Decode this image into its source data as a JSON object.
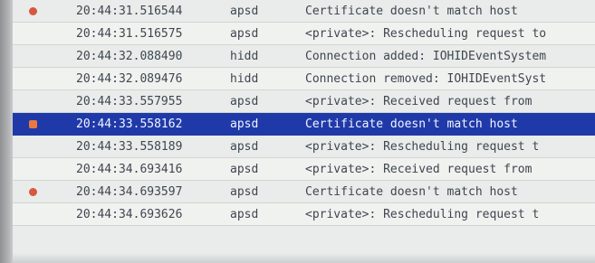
{
  "log": {
    "rows": [
      {
        "time": "20:44:31.516544",
        "process": "apsd",
        "message": "Certificate doesn't match host",
        "fault": true,
        "selected": false
      },
      {
        "time": "20:44:31.516575",
        "process": "apsd",
        "message": "<private>: Rescheduling request to",
        "fault": false,
        "selected": false
      },
      {
        "time": "20:44:32.088490",
        "process": "hidd",
        "message": "Connection added: IOHIDEventSystem",
        "fault": false,
        "selected": false
      },
      {
        "time": "20:44:32.089476",
        "process": "hidd",
        "message": "Connection removed: IOHIDEventSyst",
        "fault": false,
        "selected": false
      },
      {
        "time": "20:44:33.557955",
        "process": "apsd",
        "message": "<private>: Received request from",
        "fault": false,
        "selected": false
      },
      {
        "time": "20:44:33.558162",
        "process": "apsd",
        "message": "Certificate doesn't match host",
        "fault": true,
        "selected": true
      },
      {
        "time": "20:44:33.558189",
        "process": "apsd",
        "message": "<private>: Rescheduling request t",
        "fault": false,
        "selected": false
      },
      {
        "time": "20:44:34.693416",
        "process": "apsd",
        "message": "<private>: Received request from",
        "fault": false,
        "selected": false
      },
      {
        "time": "20:44:34.693597",
        "process": "apsd",
        "message": "Certificate doesn't match host",
        "fault": true,
        "selected": false
      },
      {
        "time": "20:44:34.693626",
        "process": "apsd",
        "message": "<private>: Rescheduling request t",
        "fault": false,
        "selected": false
      }
    ]
  },
  "colors": {
    "selection": "#1f3aa8",
    "fault_dot": "#d8573f"
  },
  "icons": {
    "fault_marker": "fault-dot-icon"
  }
}
